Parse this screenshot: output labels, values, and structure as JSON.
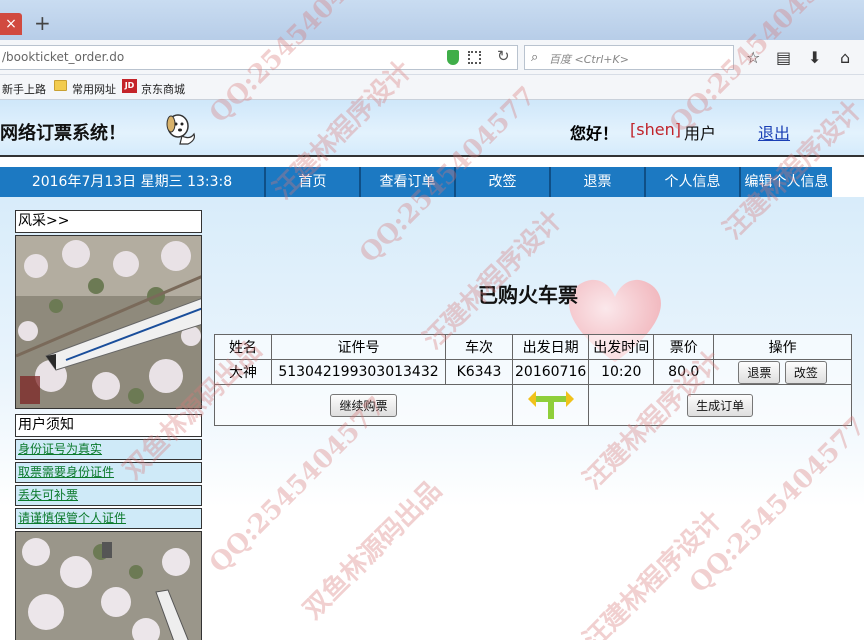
{
  "browser": {
    "tab_close": "×",
    "tab_new": "+",
    "url": "/bookticket_order.do",
    "search_placeholder": "百度 <Ctrl+K>",
    "bookmarks": [
      "新手上路",
      "常用网址",
      "京东商城"
    ],
    "jd_badge": "JD"
  },
  "header": {
    "site_title": "网络订票系统！",
    "greeting": "您好！",
    "username": "[shen]",
    "user_suffix": "用户",
    "logout": "退出"
  },
  "menu": {
    "datetime": "2016年7月13日 星期三 13:3:8",
    "items": [
      "首页",
      "查看订单",
      "改签",
      "退票",
      "个人信息",
      "编辑个人信息"
    ]
  },
  "sidebar": {
    "scenery_heading": "风采>>",
    "notice_heading": "用户须知",
    "links": [
      "身份证号为真实",
      "取票需要身份证件",
      "丢失可补票",
      "请谨慎保管个人证件"
    ]
  },
  "main": {
    "title": "已购火车票",
    "columns": [
      "姓名",
      "证件号",
      "车次",
      "出发日期",
      "出发时间",
      "票价",
      "操作"
    ],
    "rows": [
      {
        "name": "大神",
        "id_number": "513042199303013432",
        "train": "K6343",
        "date": "20160716",
        "time": "10:20",
        "price": "80.0",
        "refund": "退票",
        "change": "改签"
      }
    ],
    "continue_button": "继续购票",
    "create_order_button": "生成订单"
  },
  "watermark": {
    "lines": [
      "QQ:2545404577",
      "汪建林程序设计",
      "双鱼林源码出品"
    ]
  }
}
